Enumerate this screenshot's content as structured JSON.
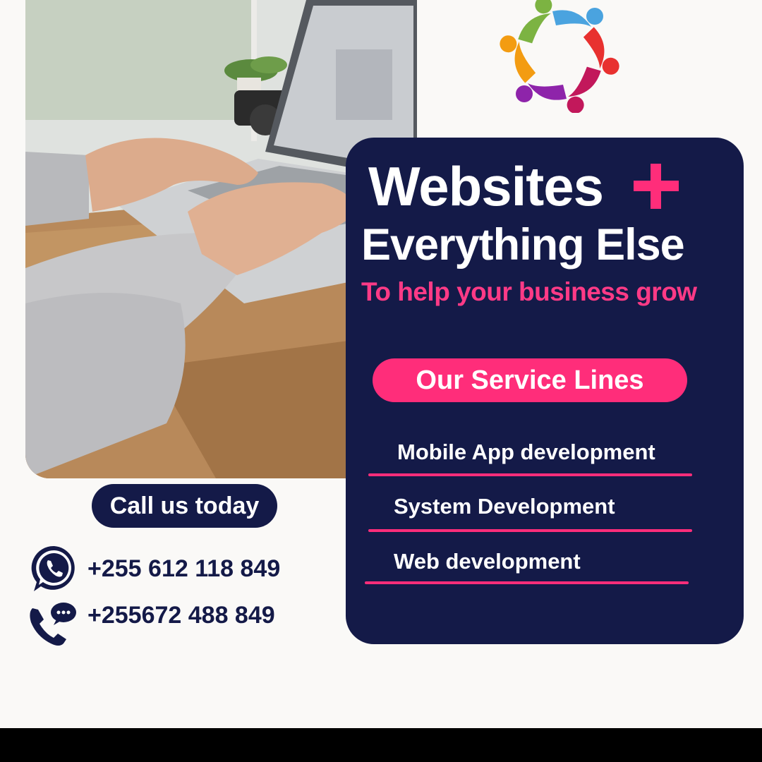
{
  "headline": {
    "line1": "Websites",
    "line2": "Everything Else",
    "tagline": "To help your business grow"
  },
  "services": {
    "title": "Our Service Lines",
    "items": [
      {
        "label": "Mobile App development"
      },
      {
        "label": "System Development"
      },
      {
        "label": "Web development"
      }
    ]
  },
  "contact": {
    "cta": "Call us today",
    "whatsapp": "+255 612 118 849",
    "phone": "+255672 488 849"
  },
  "icons": {
    "logo": "people-circle-logo",
    "accent": "plus-icon",
    "whatsapp": "whatsapp-icon",
    "phone": "phone-chat-icon"
  },
  "colors": {
    "navy": "#141a48",
    "pink": "#ff2d7a",
    "background": "#faf9f7"
  }
}
